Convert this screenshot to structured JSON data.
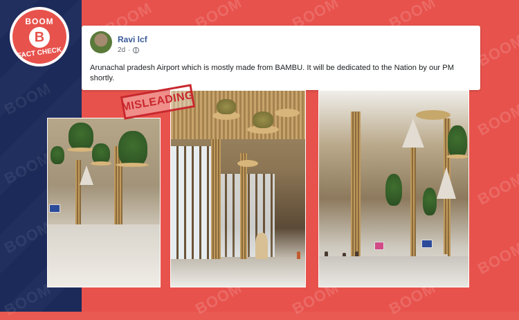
{
  "brand": {
    "badge_top": "BOOM",
    "badge_letter": "B",
    "badge_bottom": "FACT CHECK",
    "watermark": "BOOM",
    "colors": {
      "red": "#e8524c",
      "navy": "#1d2b5c",
      "stamp": "#c8282d"
    }
  },
  "post": {
    "author": "Ravi lcf",
    "time": "2d",
    "privacy_icon": "globe-icon",
    "text": "Arunachal pradesh Airport which is mostly made from BAMBU. It will be dedicated to the Nation by our PM shortly."
  },
  "stamp": {
    "label": "MISLEADING"
  }
}
